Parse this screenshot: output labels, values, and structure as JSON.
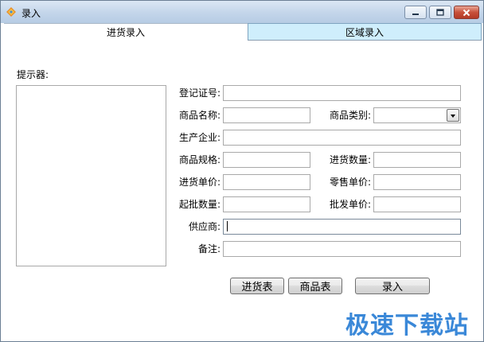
{
  "window": {
    "title": "录入"
  },
  "tabs": [
    {
      "label": "进货录入",
      "active": true
    },
    {
      "label": "区域录入",
      "active": false
    }
  ],
  "hint": {
    "label": "提示器:",
    "content": ""
  },
  "form": {
    "reg_no": {
      "label": "登记证号:",
      "value": ""
    },
    "product_name": {
      "label": "商品名称:",
      "value": ""
    },
    "category": {
      "label": "商品类别:",
      "value": ""
    },
    "manufacturer": {
      "label": "生产企业:",
      "value": ""
    },
    "spec": {
      "label": "商品规格:",
      "value": ""
    },
    "purchase_qty": {
      "label": "进货数量:",
      "value": ""
    },
    "purchase_price": {
      "label": "进货单价:",
      "value": ""
    },
    "retail_price": {
      "label": "零售单价:",
      "value": ""
    },
    "min_batch_qty": {
      "label": "起批数量:",
      "value": ""
    },
    "wholesale_price": {
      "label": "批发单价:",
      "value": ""
    },
    "supplier": {
      "label": "供应商:",
      "value": ""
    },
    "remark": {
      "label": "备注:",
      "value": ""
    }
  },
  "buttons": {
    "purchase_table": "进货表",
    "product_table": "商品表",
    "submit": "录入"
  },
  "watermark": "极速下载站",
  "colors": {
    "titlebar": "#c3d5ea",
    "inactive_tab": "#cfeefc",
    "watermark": "#3a88d8",
    "close_button": "#c8503a"
  },
  "icons": {
    "app": "app-logo-icon",
    "minimize": "minimize-icon",
    "maximize": "maximize-icon",
    "close": "close-icon",
    "dropdown": "chevron-down-icon"
  }
}
